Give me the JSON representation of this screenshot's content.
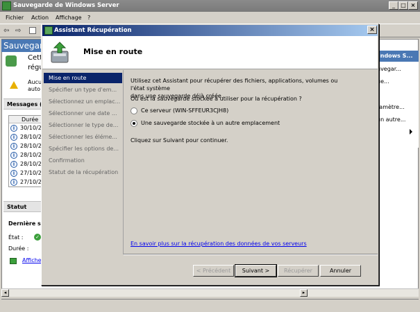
{
  "window": {
    "title": "Sauvegarde de Windows Server"
  },
  "menu": {
    "items": [
      "Fichier",
      "Action",
      "Affichage",
      "?"
    ]
  },
  "background": {
    "header": "Sauvegard",
    "desc_line1": "Cett",
    "desc_line2": "régu",
    "warn_line1": "Aucu",
    "warn_line2": "auto",
    "messages_title": "Messages (",
    "duration_header": "Durée",
    "message_dates": [
      "30/10/2",
      "28/10/2",
      "28/10/2",
      "28/10/2",
      "28/10/2",
      "27/10/2",
      "27/10/2"
    ],
    "status_title": "Statut",
    "last_title": "Dernière s",
    "state_label": "État :",
    "duration_label": "Durée :",
    "view_link": "Afficher"
  },
  "actions_panel": {
    "header": "indows S...",
    "items": [
      "uvegar...",
      "ue...",
      "ramètre...",
      "un autre..."
    ]
  },
  "dialog": {
    "title": "Assistant Récupération",
    "heading": "Mise en route",
    "steps": [
      "Mise en route",
      "Spécifier un type d'em...",
      "Sélectionnez un emplac...",
      "Sélectionner une date ...",
      "Sélectionner le type de...",
      "Sélectionner les éléme...",
      "Spécifier les options de...",
      "Confirmation",
      "Statut de la récupération"
    ],
    "intro_line1": "Utilisez cet Assistant pour récupérer des fichiers, applications, volumes ou l'état système",
    "intro_line2": "dans une sauvegarde déjà créée.",
    "question": "Où est la sauvegarde stockée à utiliser pour la récupération ?",
    "option_server": "Ce serveur (WIN-SFFEUR3CJH8)",
    "option_other": "Une sauvegarde stockée à un autre emplacement",
    "selected_option": "other",
    "continue_text": "Cliquez sur Suivant pour continuer.",
    "learn_more": "En savoir plus sur la récupération des données de vos serveurs",
    "buttons": {
      "previous": "< Précédent",
      "next": "Suivant >",
      "recover": "Récupérer",
      "cancel": "Annuler"
    }
  }
}
